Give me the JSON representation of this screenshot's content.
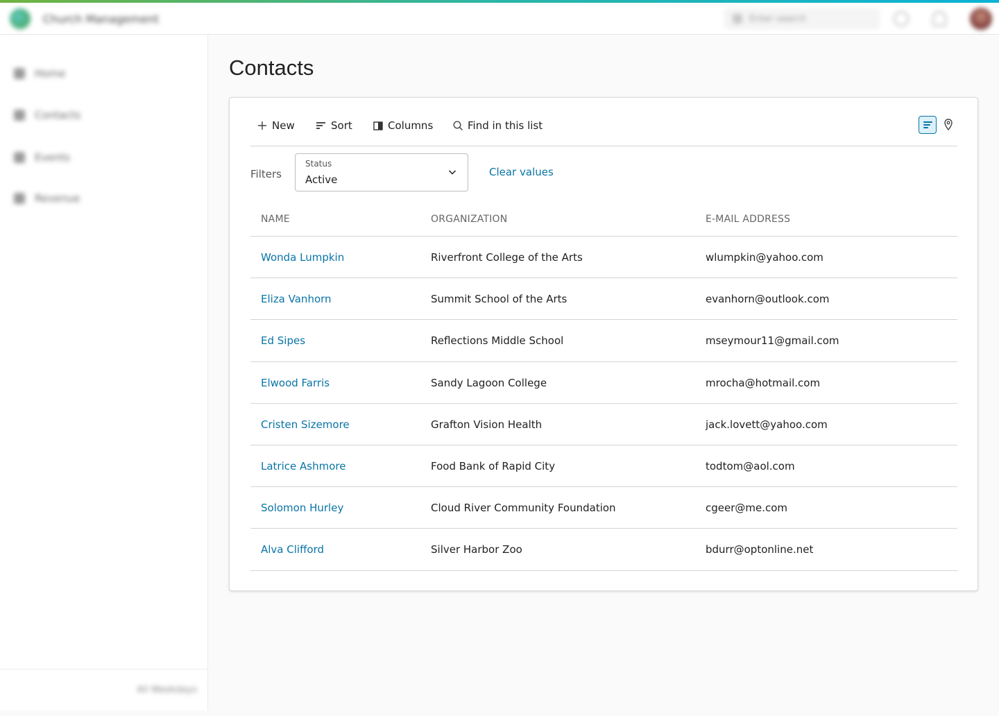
{
  "app": {
    "title": "Church Management",
    "search_placeholder": "Enter search",
    "version": "All Weekdays"
  },
  "sidebar": {
    "items": [
      {
        "label": "Home",
        "icon": "home-icon"
      },
      {
        "label": "Contacts",
        "icon": "person-icon"
      },
      {
        "label": "Events",
        "icon": "calendar-icon"
      },
      {
        "label": "Revenue",
        "icon": "money-icon"
      }
    ]
  },
  "page": {
    "title": "Contacts"
  },
  "toolbar": {
    "new_label": "New",
    "sort_label": "Sort",
    "columns_label": "Columns",
    "find_label": "Find in this list"
  },
  "filters": {
    "label": "Filters",
    "status_label": "Status",
    "status_value": "Active",
    "clear_label": "Clear values"
  },
  "table": {
    "headers": [
      "NAME",
      "ORGANIZATION",
      "E-MAIL ADDRESS"
    ],
    "rows": [
      {
        "name": "Wonda Lumpkin",
        "organization": "Riverfront College of the Arts",
        "email": "wlumpkin@yahoo.com"
      },
      {
        "name": "Eliza Vanhorn",
        "organization": "Summit School of the Arts",
        "email": "evanhorn@outlook.com"
      },
      {
        "name": "Ed Sipes",
        "organization": "Reflections Middle School",
        "email": "mseymour11@gmail.com"
      },
      {
        "name": "Elwood Farris",
        "organization": "Sandy Lagoon College",
        "email": "mrocha@hotmail.com"
      },
      {
        "name": "Cristen Sizemore",
        "organization": "Grafton Vision Health",
        "email": "jack.lovett@yahoo.com"
      },
      {
        "name": "Latrice Ashmore",
        "organization": "Food Bank of Rapid City",
        "email": "todtom@aol.com"
      },
      {
        "name": "Solomon Hurley",
        "organization": "Cloud River Community Foundation",
        "email": "cgeer@me.com"
      },
      {
        "name": "Alva Clifford",
        "organization": "Silver Harbor Zoo",
        "email": "bdurr@optonline.net"
      }
    ]
  },
  "colors": {
    "link": "#0974a6",
    "accent_start": "#71b340",
    "accent_end": "#0ab2d6"
  }
}
